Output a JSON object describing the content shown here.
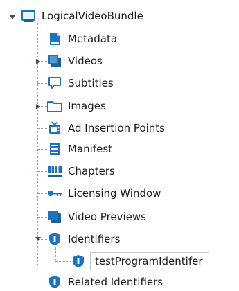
{
  "tree": {
    "root": {
      "label": "LogicalVideoBundle",
      "icon": "bundle-icon",
      "expanded": true
    },
    "items": [
      {
        "label": "Metadata",
        "icon": "metadata-icon"
      },
      {
        "label": "Videos",
        "icon": "videos-icon",
        "collapsed": true
      },
      {
        "label": "Subtitles",
        "icon": "subtitles-icon"
      },
      {
        "label": "Images",
        "icon": "folder-icon",
        "collapsed": true
      },
      {
        "label": "Ad Insertion Points",
        "icon": "tv-icon"
      },
      {
        "label": "Manifest",
        "icon": "manifest-icon"
      },
      {
        "label": "Chapters",
        "icon": "chapters-icon"
      },
      {
        "label": "Licensing Window",
        "icon": "key-icon"
      },
      {
        "label": "Video Previews",
        "icon": "video-previews-icon"
      },
      {
        "label": "Identifiers",
        "icon": "identifier-shield-icon",
        "expanded": true
      },
      {
        "label": "Related Identifiers",
        "icon": "identifier-shield-icon"
      }
    ],
    "identifier_child": {
      "label": "testProgramIdentifer",
      "icon": "identifier-shield-icon",
      "selected": true
    }
  },
  "colors": {
    "accent_blue": "#1e73be",
    "text": "#1a1a1a",
    "connector": "#9a9a9a"
  }
}
